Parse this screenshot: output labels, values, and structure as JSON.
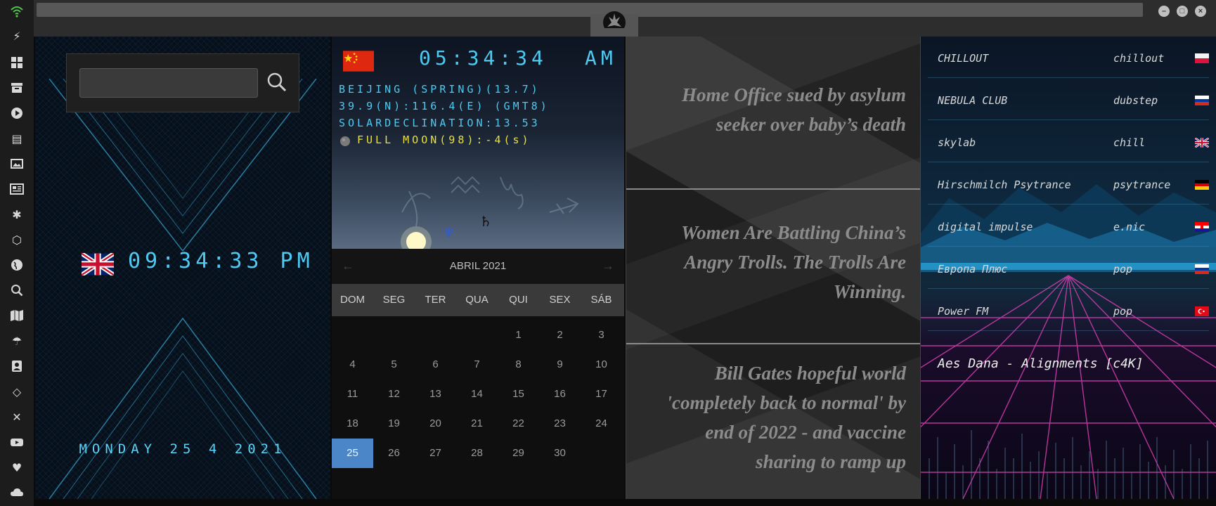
{
  "rail": {
    "icons": [
      "wifi-icon",
      "lightning-icon",
      "windows-icon",
      "archive-icon",
      "play-icon",
      "map-book-icon",
      "image-icon",
      "newspaper-icon",
      "settings-icon",
      "hexagon-icon",
      "globe-icon",
      "search-icon",
      "map-icon",
      "umbrella-icon",
      "contacts-icon",
      "code-icon",
      "expand-icon",
      "youtube-icon",
      "heart-icon",
      "cloud-icon"
    ]
  },
  "clock": {
    "time": "09:34:33 PM",
    "date": "MONDAY 25 4 2021"
  },
  "astro": {
    "time": "05:34:34",
    "ampm": "AM",
    "line1": "BEIJING (SPRING)(13.7)",
    "line2": "39.9(N):116.4(E) (GMT8)",
    "line3": "SOLARDECLINATION:13.53",
    "line4": "FULL MOON(98):-4(s)"
  },
  "calendar": {
    "month": "ABRIL 2021",
    "weekdays": [
      "DOM",
      "SEG",
      "TER",
      "QUA",
      "QUI",
      "SEX",
      "SÁB"
    ],
    "week1": [
      "",
      "",
      "",
      "",
      "1",
      "2",
      "3"
    ],
    "week2": [
      "4",
      "5",
      "6",
      "7",
      "8",
      "9",
      "10"
    ],
    "week3": [
      "11",
      "12",
      "13",
      "14",
      "15",
      "16",
      "17"
    ],
    "week4": [
      "18",
      "19",
      "20",
      "21",
      "22",
      "23",
      "24"
    ],
    "week5": [
      "25",
      "26",
      "27",
      "28",
      "29",
      "30",
      ""
    ],
    "today": "25"
  },
  "news": {
    "item1": "Home Office sued by asylum seeker over baby’s death",
    "item2": "Women Are Battling China’s Angry Trolls. The Trolls Are Winning.",
    "item3": "Bill Gates hopeful world 'completely back to normal' by end of 2022 - and vaccine sharing to ramp up"
  },
  "radio": {
    "stations": [
      {
        "name": "CHILLOUT",
        "genre": "chillout",
        "flag": "poland"
      },
      {
        "name": "NEBULA CLUB",
        "genre": "dubstep",
        "flag": "russia"
      },
      {
        "name": "skylab",
        "genre": "chill",
        "flag": "uk"
      },
      {
        "name": "Hirschmilch Psytrance",
        "genre": "psytrance",
        "flag": "germany"
      },
      {
        "name": "digital impulse",
        "genre": "e.nic",
        "flag": "croatia"
      },
      {
        "name": "Европа Плюс",
        "genre": "pop",
        "flag": "russia"
      },
      {
        "name": "Power FM",
        "genre": "pop",
        "flag": "turkey"
      }
    ],
    "now_playing": "Aes Dana - Alignments [c4K]"
  },
  "colors": {
    "cyan": "#4fc9f0",
    "moon_yellow": "#e8e23a",
    "today_blue": "#4a86c8"
  }
}
